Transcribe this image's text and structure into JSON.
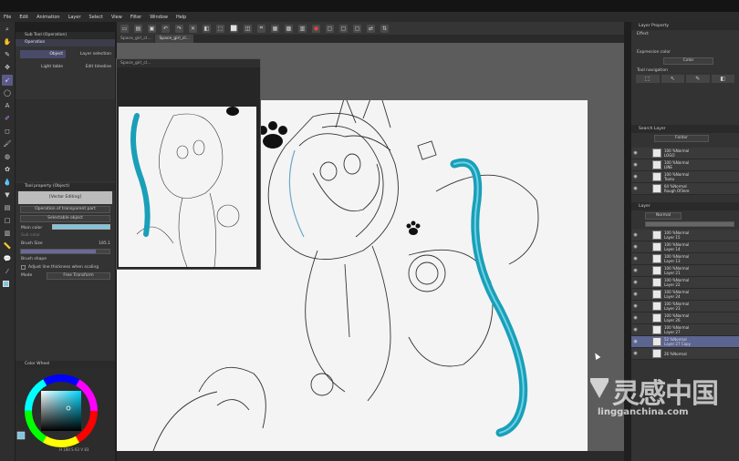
{
  "menu": [
    "File",
    "Edit",
    "Animation",
    "Layer",
    "Select",
    "View",
    "Filter",
    "Window",
    "Help"
  ],
  "doc_tabs": [
    "Space_girl_cl...",
    "Space_girl_cl..."
  ],
  "left_panel": {
    "sub_tool_header": "Sub Tool (Operation)",
    "sub_tool_group": "Operation",
    "items": [
      "Object",
      "Layer selection",
      "Light table",
      "Edit timeline"
    ],
    "tool_property_header": "Tool property (Object)",
    "vector_editing": "[Vector Editing]",
    "op_transparent": "Operation of transparent part",
    "selectable_object": "Selectable object",
    "main_color": "Main color",
    "sub_color": "Sub color",
    "brush_size_label": "Brush Size",
    "brush_size_value": "185.1",
    "brush_shape": "Brush shape",
    "adjust_line": "Adjust line thickness when scaling",
    "mode_label": "Mode",
    "mode_value": "Free Transform",
    "color_wheel_header": "Color Wheel",
    "color_readout": "H 180 S 63 V 83",
    "main_color_hex": "#7ec6de"
  },
  "subview": {
    "title": "Space_girl_cl..."
  },
  "right_panel": {
    "layer_property_header": "Layer Property",
    "effect_label": "Effect",
    "expression_color_label": "Expression color",
    "expression_color_value": "Color",
    "tool_navigation_label": "Tool navigation",
    "search_layer_header": "Search Layer",
    "search_type": "Folder",
    "search_layers": [
      {
        "pct": "100 %Normal",
        "name": "LOGO"
      },
      {
        "pct": "100 %Normal",
        "name": "LINE"
      },
      {
        "pct": "100 %Normal",
        "name": "Tsuku"
      },
      {
        "pct": "64 %Normal",
        "name": "Rough Of3ere"
      }
    ],
    "layer_header": "Layer",
    "blend_mode": "Normal",
    "layers": [
      {
        "pct": "100 %Normal",
        "name": "Layer 15",
        "selected": false
      },
      {
        "pct": "100 %Normal",
        "name": "Layer 14",
        "selected": false
      },
      {
        "pct": "100 %Normal",
        "name": "Layer 13",
        "selected": false
      },
      {
        "pct": "100 %Normal",
        "name": "Layer 21",
        "selected": false
      },
      {
        "pct": "100 %Normal",
        "name": "Layer 22",
        "selected": false
      },
      {
        "pct": "100 %Normal",
        "name": "Layer 24",
        "selected": false
      },
      {
        "pct": "100 %Normal",
        "name": "Layer 23",
        "selected": false
      },
      {
        "pct": "100 %Normal",
        "name": "Layer 26",
        "selected": false
      },
      {
        "pct": "100 %Normal",
        "name": "Layer 27",
        "selected": false
      },
      {
        "pct": "52 %Normal",
        "name": "Layer 27 Copy",
        "selected": true
      },
      {
        "pct": "26 %Normal",
        "name": "",
        "selected": false
      }
    ]
  },
  "watermark": {
    "cn": "灵感中国",
    "url": "lingganchina.com"
  },
  "accent": "#5c6490",
  "tube_color": "#1a9fb8"
}
